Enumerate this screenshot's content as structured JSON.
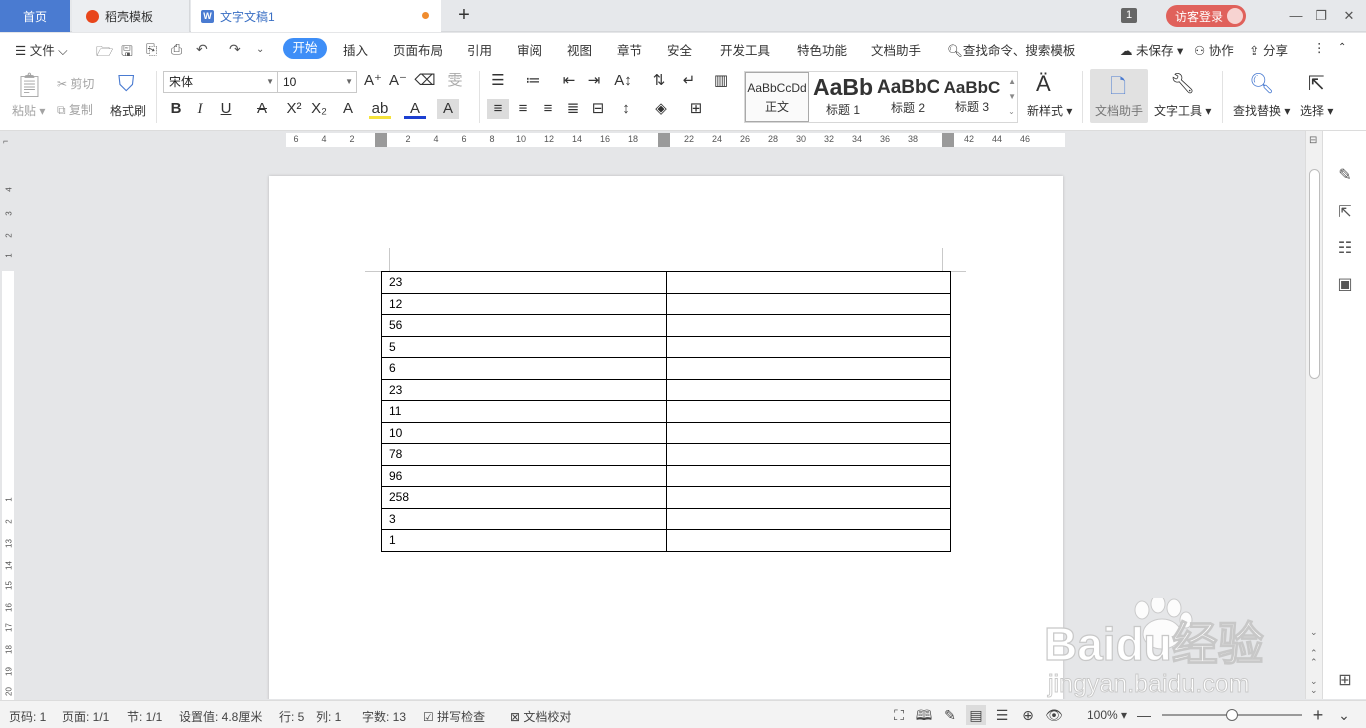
{
  "tabs": {
    "home": "首页",
    "daoke": "稻壳模板",
    "document": "文字文稿1",
    "window_count": "1",
    "login": "访客登录"
  },
  "menu": {
    "file": "文件",
    "start": "开始",
    "insert": "插入",
    "layout": "页面布局",
    "reference": "引用",
    "review": "审阅",
    "view": "视图",
    "chapter": "章节",
    "security": "安全",
    "developer": "开发工具",
    "special": "特色功能",
    "doc_helper": "文档助手",
    "search": "查找命令、搜索模板",
    "unsaved": "未保存",
    "collaborate": "协作",
    "share": "分享"
  },
  "ribbon": {
    "paste": "粘贴",
    "cut": "剪切",
    "copy": "复制",
    "format_painter": "格式刷",
    "font_name": "宋体",
    "font_size": "10",
    "styles": [
      {
        "sample": "AaBbCcDd",
        "label": "正文"
      },
      {
        "sample": "AaBb",
        "label": "标题 1"
      },
      {
        "sample": "AaBbC",
        "label": "标题 2"
      },
      {
        "sample": "AaBbC",
        "label": "标题 3"
      }
    ],
    "new_style": "新样式",
    "doc_helper": "文档助手",
    "text_tools": "文字工具",
    "find_replace": "查找替换",
    "select": "选择"
  },
  "ruler": {
    "h_ticks": [
      "6",
      "4",
      "2",
      "2",
      "4",
      "6",
      "8",
      "10",
      "12",
      "14",
      "16",
      "18",
      "22",
      "24",
      "26",
      "28",
      "30",
      "32",
      "34",
      "36",
      "38",
      "42",
      "44",
      "46"
    ],
    "v_ticks": [
      "4",
      "3",
      "2",
      "1",
      "1",
      "2",
      "13",
      "14",
      "15",
      "16",
      "17",
      "18",
      "19",
      "20"
    ]
  },
  "table": {
    "rows": [
      [
        "23",
        ""
      ],
      [
        "12",
        ""
      ],
      [
        "56",
        ""
      ],
      [
        "5",
        ""
      ],
      [
        "6",
        ""
      ],
      [
        "23",
        ""
      ],
      [
        "11",
        ""
      ],
      [
        "10",
        ""
      ],
      [
        "78",
        ""
      ],
      [
        "96",
        ""
      ],
      [
        "258",
        ""
      ],
      [
        "3",
        ""
      ],
      [
        "1",
        ""
      ]
    ]
  },
  "status": {
    "page_no": "页码: 1",
    "pages": "页面: 1/1",
    "section": "节: 1/1",
    "setting": "设置值: 4.8厘米",
    "row": "行: 5",
    "col": "列: 1",
    "word_count": "字数: 13",
    "spell_check": "拼写检查",
    "doc_proof": "文档校对",
    "zoom": "100%",
    "zoom_level_percent": 100
  },
  "watermark": {
    "brand": "Baidu经验",
    "url": "jingyan.baidu.com"
  },
  "colors": {
    "accent": "#3e8ef7",
    "home_tab": "#4a7bd1",
    "login": "#e0615b",
    "modified_dot": "#f08c2e"
  }
}
